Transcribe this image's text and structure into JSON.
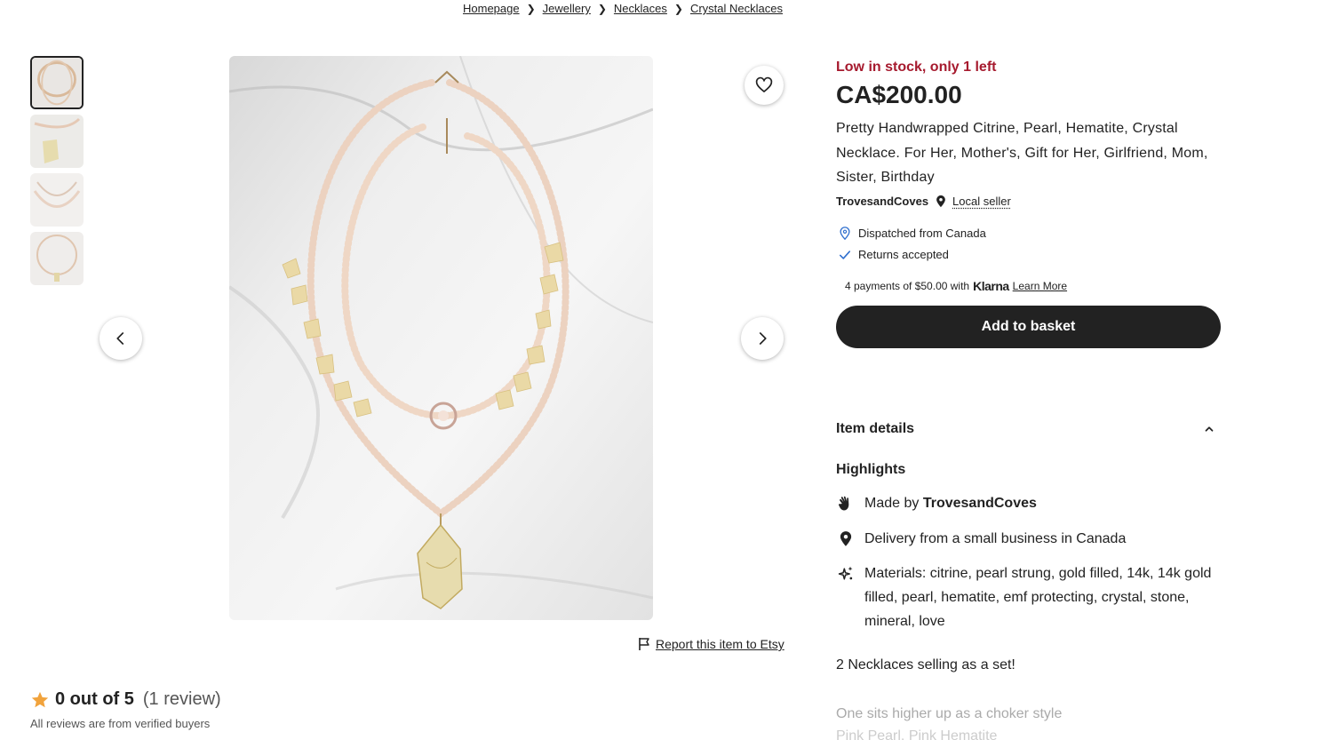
{
  "breadcrumb": [
    "Homepage",
    "Jewellery",
    "Necklaces",
    "Crystal Necklaces"
  ],
  "product": {
    "stock_notice": "Low in stock, only 1 left",
    "price": "CA$200.00",
    "title": "Pretty Handwrapped Citrine, Pearl, Hematite, Crystal Necklace. For Her, Mother's, Gift for Her, Girlfriend, Mom, Sister, Birthday",
    "seller": "TrovesandCoves",
    "local_seller": "Local seller",
    "perks": [
      "Dispatched from Canada",
      "Returns accepted"
    ]
  },
  "klarna": {
    "text": "4 payments of $50.00 with",
    "logo": "Klarna",
    "learn_more": "Learn More"
  },
  "add_to_basket": "Add to basket",
  "report": "Report this item to Etsy",
  "rating": {
    "score": "0 out of 5",
    "count": "(1 review)",
    "verified": "All reviews are from verified buyers"
  },
  "details": {
    "heading": "Item details",
    "highlights_heading": "Highlights",
    "made_by_prefix": "Made by",
    "made_by_name": "TrovesandCoves",
    "delivery": "Delivery from a small business in Canada",
    "materials": "Materials: citrine, pearl strung, gold filled, 14k, 14k gold filled, pearl, hematite, emf protecting, crystal, stone, mineral, love",
    "desc1": "2 Necklaces selling as a set!",
    "desc2": "One sits higher up as a choker style",
    "desc3": "Pink Pearl, Pink Hematite"
  },
  "colors": {
    "stock_red": "#a61a2e",
    "button_dark": "#222222",
    "link_blue": "#2f6fce"
  },
  "icons": [
    "heart-icon",
    "chevron-left-icon",
    "chevron-right-icon",
    "flag-icon",
    "star-icon",
    "map-pin-icon",
    "check-icon",
    "hand-wave-icon",
    "sparkle-icon",
    "chevron-up-icon"
  ]
}
